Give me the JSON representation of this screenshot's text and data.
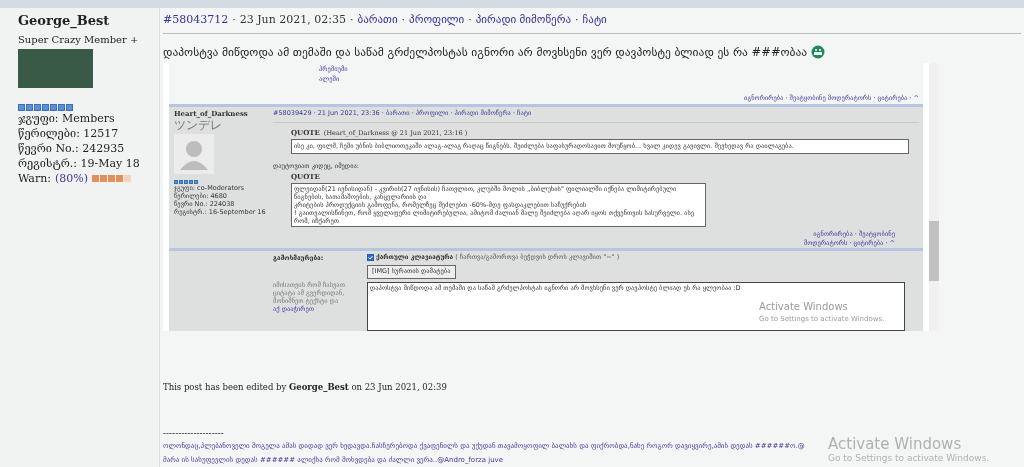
{
  "author": {
    "name": "George_Best",
    "title": "Super Crazy Member +",
    "details": [
      "ჯგუფი: Members",
      "წერილები: 12517",
      "წევრი No.: 242935",
      "რეგისტრ.: 19-May 18"
    ],
    "warn_label": "Warn:",
    "warn_value": "(80%)",
    "warn": {
      "level": 0.8
    }
  },
  "post": {
    "separator": "·",
    "number": "#58043712",
    "date": "23 Jun 2021, 02:35",
    "links": [
      "ბარათი",
      "პროფილი",
      "პირადი მიმოწერა",
      "ჩატი"
    ],
    "message": "დაპოსტვა მიწდოდა ამ თემაში და საწამ გრძელპოსტას იგნორი არ მოვხსენი ვერ დავპოსტე ბლიად ეს რა ###ობაა",
    "edited": "This post has been edited by **George_Best** on 23 Jun 2021, 02:39",
    "signature_rule": "--------------------",
    "signature": [
      "ოლონდაც,პლებანოველი მოგელა ამას დიდად ვერ ხედავდა.ჩასჩერებოდა ქვაფენილს და უქუდან თავამოყოფილ ბალახს და ფიქრობდა,ნახე როგორ დავიყვირე,ამის დედას ######ო.@",
      "მარა ის სასუფევლის დედას ###### ალიქსა რომ მოხვდება და ძალლი ვერა..@Andro_forza juve"
    ]
  },
  "screenshot": {
    "top_links": [
      "პრემიუმი",
      "ალეში"
    ],
    "top_footer": "იგნორირება · შეატყობინე მოდერატორს · ციტირება · ^",
    "post": {
      "author": "Heart_of_Darkness",
      "title": "ツンデレ",
      "details": [
        "ჯგუფი: co-Moderators",
        "წერილები: 4680",
        "წევრი No.: 224038",
        "რეგისტრ.: 16-September 16"
      ],
      "header": "#58039429 · 21 Jun 2021, 23:36 · ბარათი · პროფილი · პირადი მიმოწერა · ჩატი",
      "quote1_label": "QUOTE",
      "quote1_source": "(Heart_of_Darkness @ 21 Jun 2021, 23:16 )",
      "quote1": "ისე კი, ფილმ, ჩემი უბნის ბიბლიოთეკაში ალაგ-ალაგ რაღაც წიგნებს. შეიძლება საფასურადოსავით მოუწყობ... ხვალ კიდევ გავივლი. შევხედავ რა დაილაგება.",
      "reply": "დაუტოვიათ კიდეც, იმედია:",
      "quote2_label": "QUOTE",
      "quote2": [
        "ფლეიდან(21 ივნისიდან) - კვირის(27 ივნისის) ჩათვლით, კლუბში მოლის „ბიბლუხის\" ფილიალში იქნება ლიმიტირებული წიგნების, სათამაშოების, კანცელარიის და",
        "კრიტების პროდუქციის გამოფენა, რომელზეც შეძლებთ -60%-მდე ფასდაკლებით საჩუქრების",
        "! გაითვალისწინეთ, რომ ყველაფერი ლიმიტირებულია, ამიტომ ძალიან მალე შეიძლება აღარ იყოს თქვენთვის სასურველი. ასე რომ, იჩქარეთ"
      ],
      "footer": [
        "იგნორირება · შეატყობინე",
        "მოდერატორს · ციტირება · ^"
      ]
    },
    "form": {
      "label": "გამოხმაურება:",
      "keyboard_checked": true,
      "keyboard_label": "ქართული კლავიატურა",
      "keyboard_hint": "( ჩართვა/გამორთვა ბეჭდვის დროს კლავიშით \"~\" )",
      "img_button": "[IMG] სურათის დამატება",
      "help": "იმისათვის რომ ჩასვათ ციტატა ამ გვერდიდან, მონიშნეთ ტექსტი და",
      "help_link": "აქ დააჭირეთ",
      "text": "დაპოსტვა მიწდოდა ამ თემაში და საწამ გრძელპოსტას იგნორი არ მოვხსენი ვერ დავპოსტე ბლიად ეს რა ყლეობაა :D"
    },
    "activation": {
      "title": "Activate Windows",
      "hint": "Go to Settings to activate Windows."
    }
  },
  "activation": {
    "title": "Activate Windows",
    "hint": "Go to Settings to activate Windows."
  }
}
